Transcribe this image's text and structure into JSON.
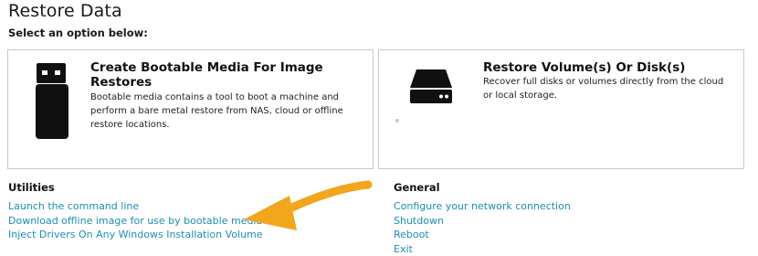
{
  "page": {
    "title": "Restore Data",
    "subtitle": "Select an option below:"
  },
  "cards": [
    {
      "icon": "usb-drive-icon",
      "title": "Create Bootable Media For Image Restores",
      "description": "Bootable media contains a tool to boot a machine and perform a bare metal restore from NAS, cloud or offline restore locations."
    },
    {
      "icon": "hard-disk-icon",
      "title": "Restore Volume(s) Or Disk(s)",
      "description": "Recover full disks or volumes directly from the cloud or local storage."
    }
  ],
  "utilities": {
    "title": "Utilities",
    "links": [
      "Launch the command line",
      "Download offline image for use by bootable media",
      "Inject Drivers On Any Windows Installation Volume"
    ]
  },
  "general": {
    "title": "General",
    "links": [
      "Configure your network connection",
      "Shutdown",
      "Reboot",
      "Exit"
    ]
  },
  "colors": {
    "link": "#1b8fb3",
    "arrow": "#f2a61c",
    "border": "#c8c8c8"
  }
}
